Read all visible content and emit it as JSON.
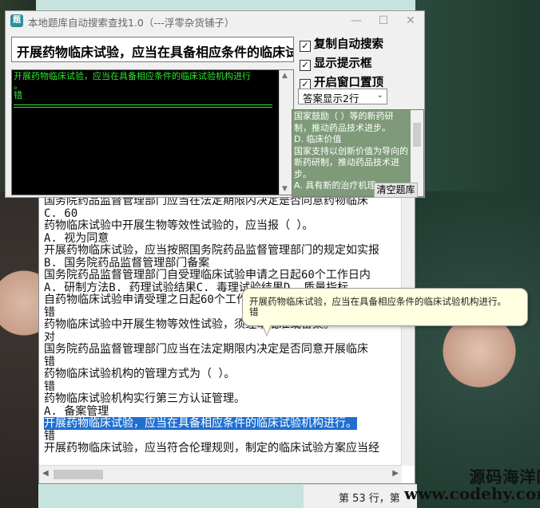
{
  "app": {
    "title": "本地题库自动搜索查找1.0（---浮零杂货铺子）",
    "window_buttons": {
      "minimize": "—",
      "maximize": "☐",
      "close": "✕"
    },
    "search_value": "开展药物临床试验，应当在具备相应条件的临床试验机构进行。",
    "result_lines": [
      "开展药物临床试验，应当在具备相应条件的临床试验机构进行",
      "。",
      "错"
    ],
    "options": [
      {
        "label": "复制自动搜索",
        "checked": true
      },
      {
        "label": "显示提示框",
        "checked": true
      },
      {
        "label": "开启窗口置顶",
        "checked": true
      }
    ],
    "answer_display_select": "答案显示2行",
    "answer_lines": [
      "国家鼓励（  ）等的新药研制，推动药品技术进步。",
      "D. 临床价值",
      "国家支持以创新价值为导向的新药研制，推动药品技术进步。",
      "A. 具有新的治疗机理"
    ],
    "clear_button": "清空题库"
  },
  "editor": {
    "lines": [
      "国务院药品监督管理部门应当在法定期限内决定是否同意药物临床",
      "C. 60",
      "药物临床试验中开展生物等效性试验的，应当报（  ）。",
      "A. 视为同意",
      "开展药物临床试验，应当按照国务院药品监督管理部门的规定如实报",
      "B. 国务院药品监督管理部门备案",
      "国务院药品监督管理部门自受理临床试验申请之日起60个工作日内",
      "A. 研制方法B. 药理试验结果C. 毒理试验结果D. 质量指标",
      "自药物临床试验申请受理之日起60个工作日内",
      "错",
      "药物临床试验中开展生物等效性试验，须经审批准或备案。",
      "对",
      "国务院药品监督管理部门应当在法定期限内决定是否同意开展临床",
      "错",
      "药物临床试验机构的管理方式为（  ）。",
      "错",
      "药物临床试验机构实行第三方认证管理。",
      "A. 备案管理",
      "开展药物临床试验，应当在具备相应条件的临床试验机构进行。",
      "错",
      "开展药物临床试验，应当符合伦理规则，制定的临床试验方案应当经"
    ],
    "highlight_line": 18,
    "status_text": "第 53 行，第"
  },
  "tooltip": {
    "line1": "开展药物临床试验，应当在具备相应条件的临床试验机构进行。",
    "line2": "错"
  },
  "watermark": {
    "line1": "源码海洋网",
    "line2": "www.codehy.com"
  }
}
